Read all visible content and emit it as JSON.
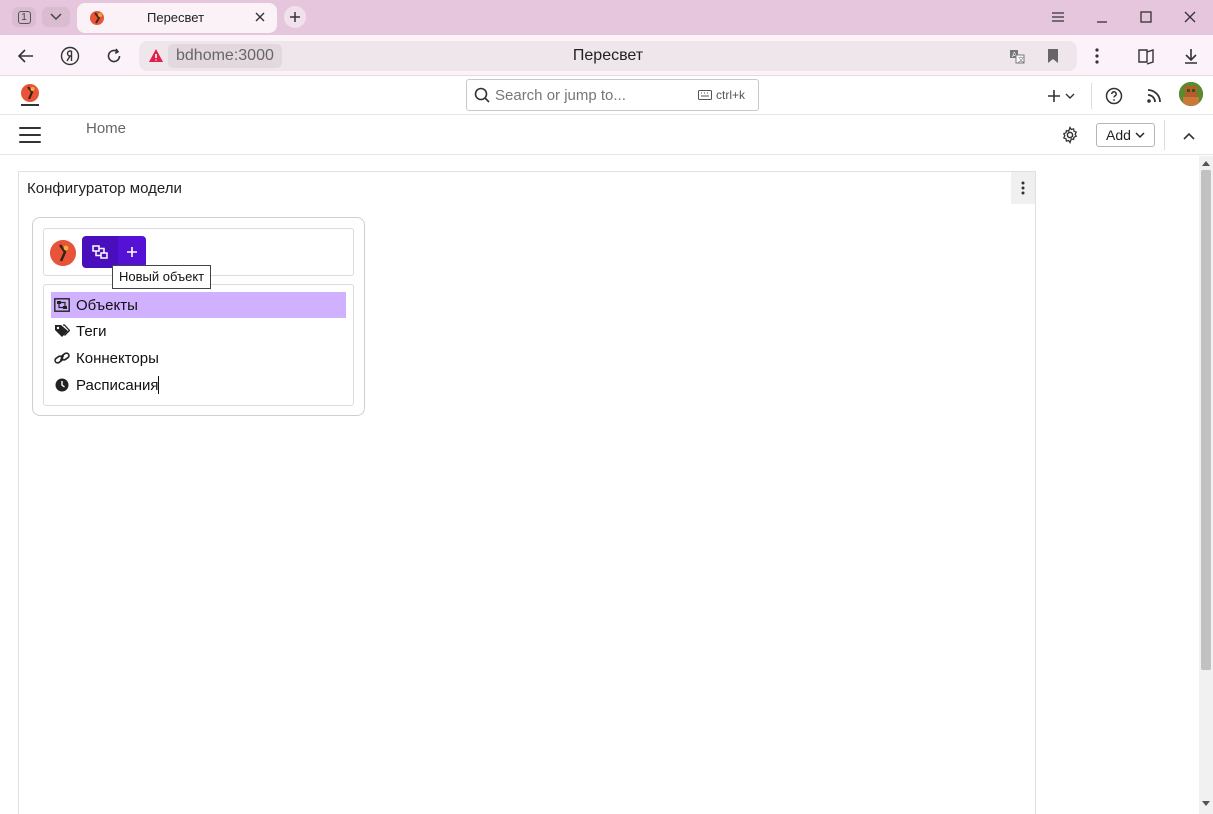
{
  "browser": {
    "tab_count": "1",
    "tab_title": "Пересвет",
    "url_host": "bdhome:3000",
    "page_title": "Пересвет"
  },
  "header": {
    "search_placeholder": "Search or jump to...",
    "search_shortcut": "ctrl+k"
  },
  "toolbar": {
    "breadcrumb": "Home",
    "add_label": "Add"
  },
  "panel": {
    "title": "Конфигуратор модели"
  },
  "model_card": {
    "tooltip": "Новый объект",
    "items": [
      {
        "label": "Объекты",
        "icon": "objects-icon",
        "active": true
      },
      {
        "label": "Теги",
        "icon": "tags-icon",
        "active": false
      },
      {
        "label": "Коннекторы",
        "icon": "link-icon",
        "active": false
      },
      {
        "label": "Расписания",
        "icon": "clock-icon",
        "active": false
      }
    ]
  },
  "colors": {
    "tabstrip": "#e6c6dd",
    "accent": "#4a0fbd",
    "active_item": "#d0b1ff"
  }
}
